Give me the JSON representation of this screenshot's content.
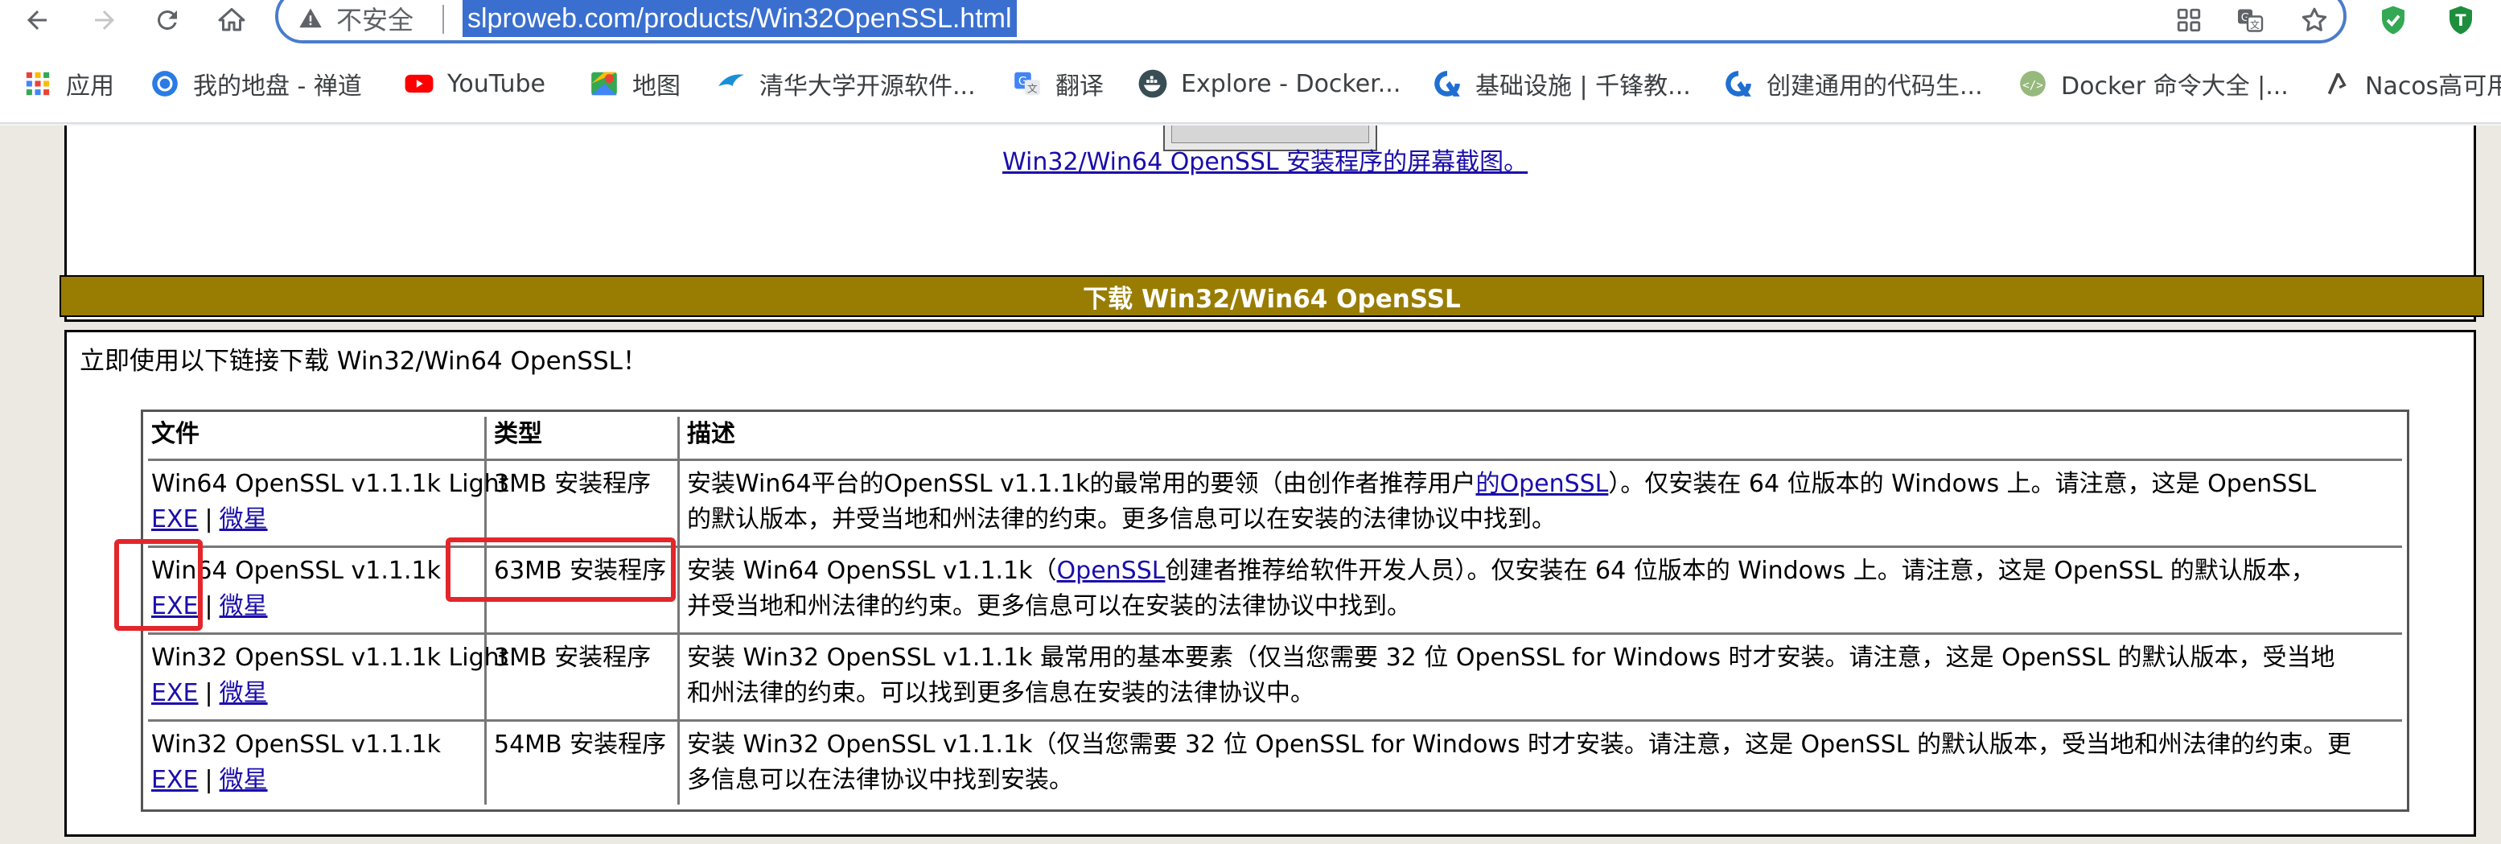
{
  "browser": {
    "security_label": "不安全",
    "url": "slproweb.com/products/Win32OpenSSL.html",
    "icons": {
      "back": "back-arrow-icon",
      "forward": "forward-arrow-icon",
      "reload": "reload-icon",
      "home": "home-icon",
      "security": "warning-triangle-icon",
      "apps_grid": "grid-icon",
      "translate": "translate-icon",
      "bookmark_star": "star-icon",
      "extension_shield": "shield-icon",
      "extension_t": "t-icon"
    },
    "accent_color": "#4a7ccb"
  },
  "bookmarks": [
    {
      "label": "应用",
      "icon": "apps-grid-icon"
    },
    {
      "label": "我的地盘 - 禅道",
      "icon": "zentao-icon"
    },
    {
      "label": "YouTube",
      "icon": "youtube-icon"
    },
    {
      "label": "地图",
      "icon": "maps-icon"
    },
    {
      "label": "清华大学开源软件...",
      "icon": "tuna-icon"
    },
    {
      "label": "翻译",
      "icon": "translate-icon"
    },
    {
      "label": "Explore - Docker...",
      "icon": "docker-icon"
    },
    {
      "label": "基础设施 | 千锋教...",
      "icon": "qianfeng-icon"
    },
    {
      "label": "创建通用的代码生...",
      "icon": "qianfeng-icon"
    },
    {
      "label": "Docker 命令大全 |...",
      "icon": "runoob-icon"
    },
    {
      "label": "Nacos高可用",
      "icon": "nacos-icon"
    }
  ],
  "page": {
    "screenshot_link": "Win32/Win64 OpenSSL 安装程序的屏幕截图。",
    "section_title": "下载 Win32/Win64 OpenSSL",
    "intro": "立即使用以下链接下载 Win32/Win64 OpenSSL！",
    "header_color": "#997d03",
    "highlight_color": "#e2262b",
    "table": {
      "headers": [
        "文件",
        "类型",
        "描述"
      ],
      "rows": [
        {
          "file": "Win64 OpenSSL v1.1.1k Light",
          "link_exe": "EXE",
          "link_msi": "微星",
          "type": "3MB 安装程序",
          "desc_line1_pre": "安装Win64平台的OpenSSL v1.1.1k的最常用的要领（由创作者推荐用户",
          "desc_line1_link": "的OpenSSL",
          "desc_line1_post": "）。仅安装在 64 位版本的 Windows 上。请注意，这是 OpenSSL",
          "desc_line2": "的默认版本，并受当地和州法律的约束。更多信息可以在安装的法律协议中找到。"
        },
        {
          "file": "Win64 OpenSSL v1.1.1k",
          "link_exe": "EXE",
          "link_msi": "微星",
          "type": "63MB 安装程序",
          "desc_line1_pre": "安装 Win64 OpenSSL v1.1.1k（",
          "desc_line1_link": "OpenSSL",
          "desc_line1_post": "创建者推荐给软件开发人员）。仅安装在 64 位版本的 Windows 上。请注意，这是 OpenSSL 的默认版本，",
          "desc_line2": "并受当地和州法律的约束。更多信息可以在安装的法律协议中找到。"
        },
        {
          "file": "Win32 OpenSSL v1.1.1k Light",
          "link_exe": "EXE",
          "link_msi": "微星",
          "type": "3MB 安装程序",
          "desc_line1": "安装 Win32 OpenSSL v1.1.1k 最常用的基本要素（仅当您需要 32 位 OpenSSL for Windows 时才安装。请注意，这是 OpenSSL 的默认版本，受当地",
          "desc_line2": "和州法律的约束。可以找到更多信息在安装的法律协议中。"
        },
        {
          "file": "Win32 OpenSSL v1.1.1k",
          "link_exe": "EXE",
          "link_msi": "微星",
          "type": "54MB 安装程序",
          "desc_line1": "安装 Win32 OpenSSL v1.1.1k（仅当您需要 32 位 OpenSSL for Windows 时才安装。请注意，这是 OpenSSL 的默认版本，受当地和州法律的约束。更",
          "desc_line2": "多信息可以在法律协议中找到安装。"
        }
      ]
    }
  }
}
